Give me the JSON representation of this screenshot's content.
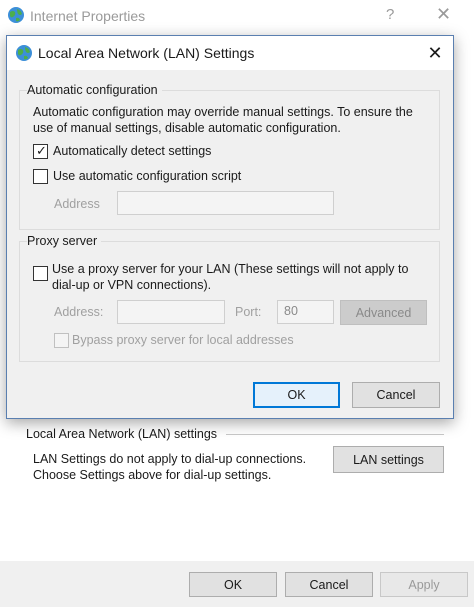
{
  "background_window": {
    "title": "Internet Properties",
    "help_glyph": "?",
    "close_glyph": "✕",
    "lan_section": {
      "title": "Local Area Network (LAN) settings",
      "description_line1": "LAN Settings do not apply to dial-up connections.",
      "description_line2": "Choose Settings above for dial-up settings.",
      "button_label": "LAN settings"
    },
    "footer": {
      "ok_label": "OK",
      "cancel_label": "Cancel",
      "apply_label": "Apply"
    }
  },
  "dialog": {
    "title": "Local Area Network (LAN) Settings",
    "close_glyph": "✕",
    "auto_config": {
      "group_label": "Automatic configuration",
      "description_line1": "Automatic configuration may override manual settings.  To ensure the",
      "description_line2": "use of manual settings, disable automatic configuration.",
      "auto_detect_label": "Automatically detect settings",
      "auto_detect_checked": true,
      "check_glyph": "✓",
      "use_script_label": "Use automatic configuration script",
      "use_script_checked": false,
      "address_label": "Address",
      "address_value": ""
    },
    "proxy": {
      "group_label": "Proxy server",
      "use_proxy_label_line1": "Use a proxy server for your LAN (These settings will not apply to",
      "use_proxy_label_line2": "dial-up or VPN connections).",
      "use_proxy_checked": false,
      "address_label": "Address:",
      "address_value": "",
      "port_label": "Port:",
      "port_value": "80",
      "advanced_label": "Advanced",
      "bypass_label": "Bypass proxy server for local addresses",
      "bypass_checked": false
    },
    "ok_label": "OK",
    "cancel_label": "Cancel"
  },
  "colors": {
    "accent": "#0078d7",
    "dialog_bg": "#f0f0f0",
    "disabled_text": "#a0a0a0"
  },
  "icons": [
    "globe-icon",
    "help-icon",
    "close-icon",
    "checkmark-icon"
  ]
}
